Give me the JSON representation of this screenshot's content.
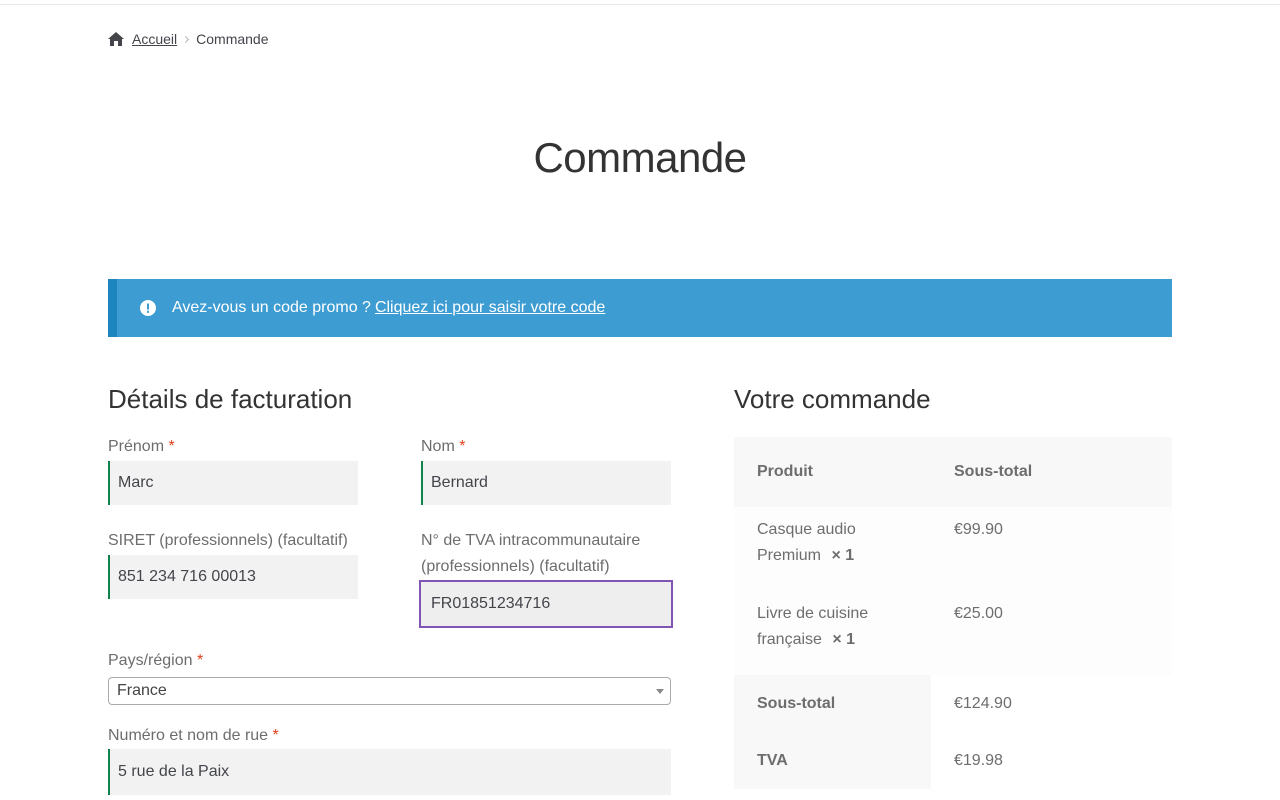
{
  "breadcrumb": {
    "home": "Accueil",
    "current": "Commande"
  },
  "page": {
    "title": "Commande"
  },
  "promo": {
    "text": "Avez-vous un code promo ?",
    "link": "Cliquez ici pour saisir votre code"
  },
  "billing": {
    "title": "Détails de facturation",
    "first_name": {
      "label": "Prénom",
      "value": "Marc"
    },
    "last_name": {
      "label": "Nom",
      "value": "Bernard"
    },
    "siret": {
      "label": "SIRET (professionnels) (facultatif)",
      "value": "851 234 716 00013"
    },
    "vat": {
      "label_line1": "N° de TVA intracommunautaire",
      "label_line2": "(professionnels) (facultatif)",
      "value": "FR01851234716"
    },
    "country": {
      "label": "Pays/région",
      "value": "France"
    },
    "street": {
      "label": "Numéro et nom de rue",
      "value": "5 rue de la Paix"
    },
    "required_mark": "*"
  },
  "order": {
    "title": "Votre commande",
    "col_product": "Produit",
    "col_subtotal": "Sous-total",
    "items": [
      {
        "name_line1": "Casque audio",
        "name_line2": "Premium",
        "qty": "× 1",
        "price": "€99.90"
      },
      {
        "name_line1": "Livre de cuisine",
        "name_line2": "française",
        "qty": "× 1",
        "price": "€25.00"
      }
    ],
    "subtotal_label": "Sous-total",
    "subtotal_value": "€124.90",
    "tax_label": "TVA",
    "tax_value": "€19.98"
  },
  "colors": {
    "promo_bg": "#3d9cd2",
    "valid_border": "#0f834d",
    "focus_border": "#7f54b3",
    "required": "#e2401c"
  }
}
